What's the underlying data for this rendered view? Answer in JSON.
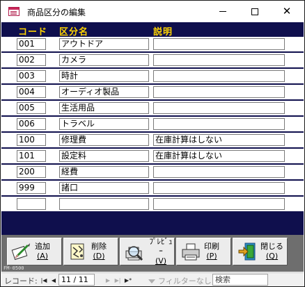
{
  "window": {
    "title": "商品区分の編集"
  },
  "headers": {
    "code": "コード",
    "name": "区分名",
    "desc": "説明"
  },
  "rows": [
    {
      "code": "001",
      "name": "アウトドア",
      "desc": ""
    },
    {
      "code": "002",
      "name": "カメラ",
      "desc": ""
    },
    {
      "code": "003",
      "name": "時計",
      "desc": ""
    },
    {
      "code": "004",
      "name": "オーディオ製品",
      "desc": ""
    },
    {
      "code": "005",
      "name": "生活用品",
      "desc": ""
    },
    {
      "code": "006",
      "name": "トラベル",
      "desc": ""
    },
    {
      "code": "100",
      "name": "修理費",
      "desc": "在庫計算はしない"
    },
    {
      "code": "101",
      "name": "設定料",
      "desc": "在庫計算はしない"
    },
    {
      "code": "200",
      "name": "経費",
      "desc": ""
    },
    {
      "code": "999",
      "name": "諸口",
      "desc": ""
    },
    {
      "code": "",
      "name": "",
      "desc": ""
    }
  ],
  "toolbar": {
    "add": {
      "label": "追加",
      "key": "(A)",
      "icon": "add-record-icon"
    },
    "delete": {
      "label": "削除",
      "key": "(D)",
      "icon": "delete-record-icon"
    },
    "preview": {
      "label": "ﾌﾟﾚﾋﾞｭｰ",
      "key": "(V)",
      "icon": "print-preview-icon"
    },
    "print": {
      "label": "印刷",
      "key": "(P)",
      "icon": "printer-icon"
    },
    "close": {
      "label": "閉じる",
      "key": "(Q)",
      "icon": "exit-door-icon"
    }
  },
  "form_id": "FM-0500",
  "navigation": {
    "label": "レコード:",
    "position": "11 / 11",
    "filter": "フィルターなし",
    "search_placeholder": "検索"
  },
  "colors": {
    "form_background": "#0f0f4d",
    "header_text": "#ffd400",
    "button_bar": "#6e6e6e"
  }
}
